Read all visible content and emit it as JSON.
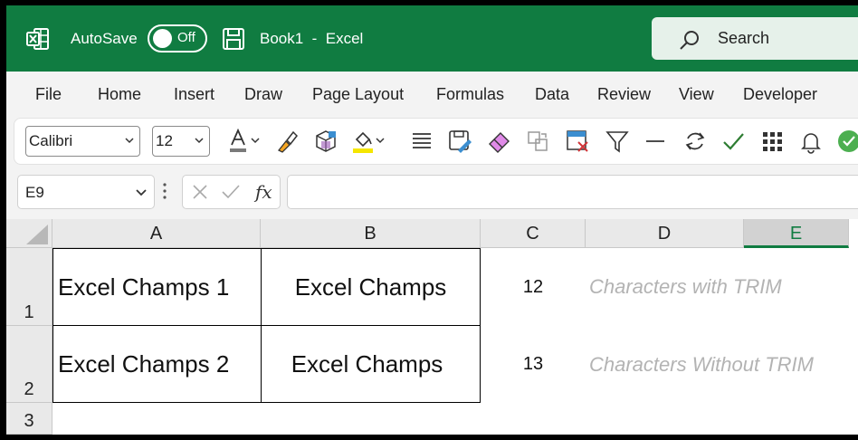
{
  "title_bar": {
    "autosave_label": "AutoSave",
    "autosave_state": "Off",
    "doc_title": "Book1  -  Excel",
    "search_placeholder": "Search",
    "brand_color": "#107c41"
  },
  "menu": {
    "items": [
      "File",
      "Home",
      "Insert",
      "Draw",
      "Page Layout",
      "Formulas",
      "Data",
      "Review",
      "View",
      "Developer"
    ]
  },
  "ribbon": {
    "font_name": "Calibri",
    "font_size": "12",
    "icons": [
      "font-color-icon",
      "format-painter-icon",
      "cube-icon",
      "fill-color-icon",
      "align-icon",
      "save-edit-icon",
      "eraser-icon",
      "paste-format-icon",
      "clear-format-icon",
      "filter-icon",
      "minus-icon",
      "refresh-icon",
      "check-icon",
      "grid-icon",
      "bell-icon",
      "check-circle-icon"
    ]
  },
  "formula_bar": {
    "name_box": "E9",
    "formula_value": ""
  },
  "grid": {
    "columns": [
      "A",
      "B",
      "C",
      "D",
      "E"
    ],
    "selected_column": "E",
    "rows": [
      "1",
      "2",
      "3"
    ],
    "cells": {
      "A1": "Excel Champs 1",
      "B1": "Excel Champs",
      "C1": "12",
      "D1": "Characters with TRIM",
      "A2": "Excel Champs 2",
      "B2": "Excel Champs",
      "C2": "13",
      "D2": "Characters Without TRIM"
    }
  }
}
